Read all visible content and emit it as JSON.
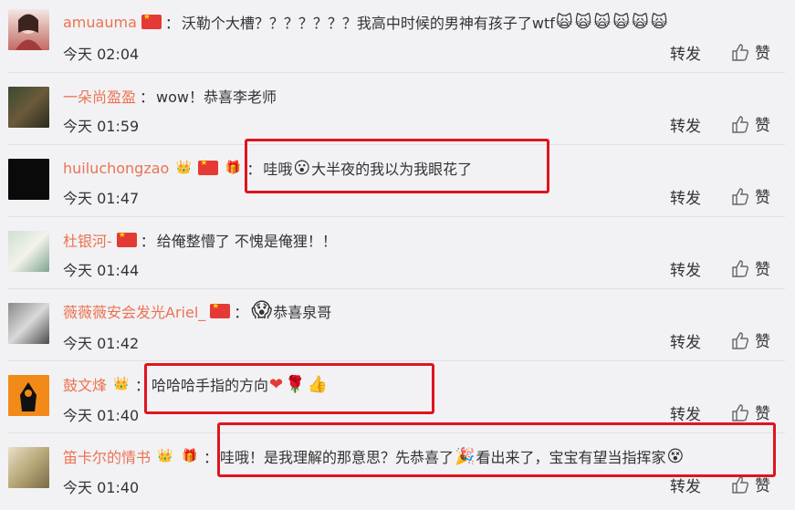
{
  "comments": [
    {
      "user": "amuauma",
      "colon": "：",
      "text": "沃勒个大槽？？？？？？？我高中时候的男神有孩子了wtf",
      "time": "今天 02:04"
    },
    {
      "user": "一朵尚盈盈",
      "colon": "：",
      "text": "wow！恭喜李老师",
      "time": "今天 01:59"
    },
    {
      "user": "huiluchongzao",
      "colon": "：",
      "text": "哇哦",
      "text2": "大半夜的我以为我眼花了",
      "time": "今天 01:47"
    },
    {
      "user": "杜银河-",
      "colon": "：",
      "text": "给俺整懵了 不愧是俺狸！！",
      "time": "今天 01:44"
    },
    {
      "user": "薇薇薇安会发光Ariel_",
      "colon": "：",
      "text": "恭喜泉哥",
      "time": "今天 01:42"
    },
    {
      "user": "鼓文烽",
      "colon": "：",
      "text": "哈哈哈手指的方向",
      "time": "今天 01:40"
    },
    {
      "user": "笛卡尔的情书",
      "colon": "：",
      "text": "哇哦！是我理解的那意思？先恭喜了",
      "text2": "看出来了，宝宝有望当指挥家",
      "time": "今天 01:40"
    }
  ],
  "actions": {
    "repost": "转发",
    "like": "赞"
  },
  "icons": [
    "flag-icon",
    "vip-badge-icon",
    "gift-badge-icon",
    "thumbs-up-icon"
  ],
  "colors": {
    "username": "#eb7350",
    "highlight": "#e0141e"
  }
}
